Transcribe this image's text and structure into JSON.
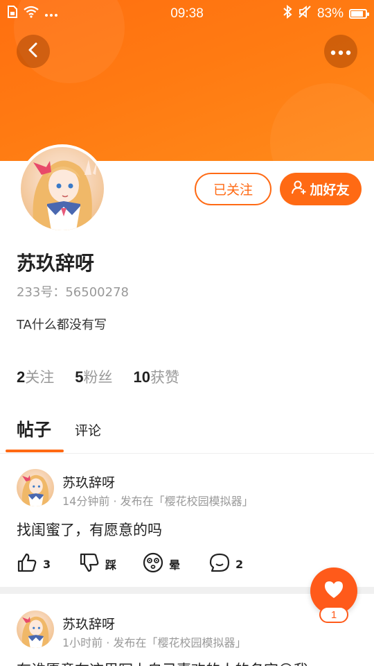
{
  "status_bar": {
    "time": "09:38",
    "battery": "83%",
    "battery_level": 0.83,
    "left_icons": [
      "sim-icon",
      "wifi-icon",
      "more-dots-icon"
    ],
    "right_icons": [
      "bluetooth-icon",
      "mute-icon",
      "battery-icon"
    ]
  },
  "header": {
    "back_icon": "chevron-left-icon",
    "more_icon": "more-dots-icon",
    "accent": "#ff6a14"
  },
  "profile": {
    "name": "苏玖辞呀",
    "id_text": "233号：56500278",
    "bio": "TA什么都没有写",
    "followed_label": "已关注",
    "add_friend_label": "加好友",
    "stats": {
      "following_num": "2",
      "following_label": "关注",
      "fans_num": "5",
      "fans_label": "粉丝",
      "likes_num": "10",
      "likes_label": "获赞"
    }
  },
  "tabs": {
    "posts": "帖子",
    "comments": "评论"
  },
  "posts": [
    {
      "author": "苏玖辞呀",
      "meta": "14分钟前 · 发布在「樱花校园模拟器」",
      "text": "找闺蜜了，有愿意的吗",
      "like_count": "3",
      "dislike_label": "踩",
      "dizzy_label": "晕",
      "comment_count": "2"
    },
    {
      "author": "苏玖辞呀",
      "meta": "1小时前 · 发布在「樱花校园模拟器」",
      "text": "有谁愿意在这里写上自己喜欢的人的名字😊我"
    }
  ],
  "fab": {
    "icon": "heart-icon",
    "count": "1"
  }
}
